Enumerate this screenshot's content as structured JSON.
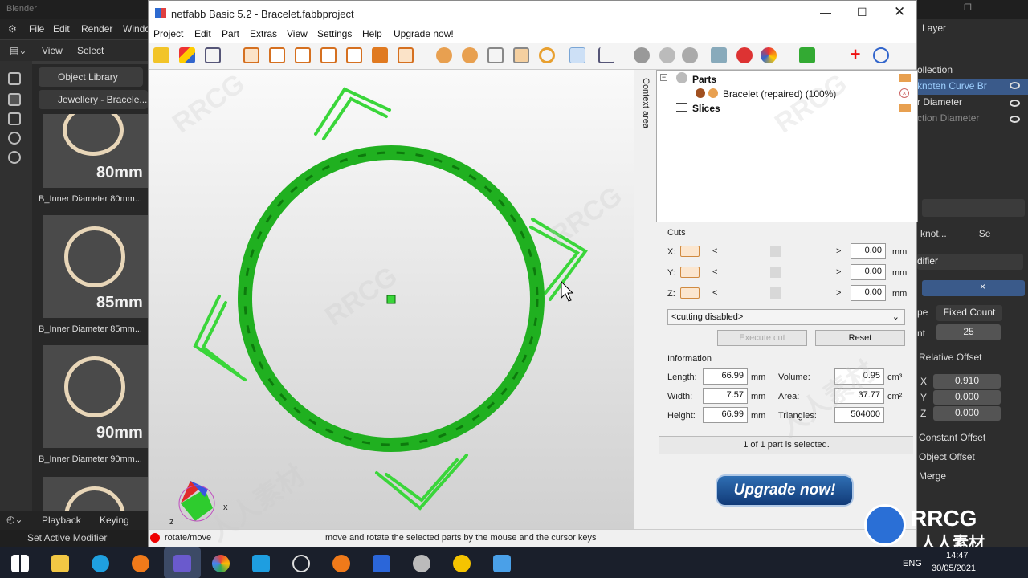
{
  "blender": {
    "title": "Blender",
    "menu": [
      "File",
      "Edit",
      "Render",
      "Windo"
    ],
    "sub_menu": [
      "View",
      "Select"
    ],
    "library_btn": "Object Library",
    "collection_btn": "Jewellery - Bracele...",
    "thumbs": [
      {
        "mm": "80mm",
        "name": "B_Inner Diameter 80mm..."
      },
      {
        "mm": "85mm",
        "name": "B_Inner Diameter 85mm..."
      },
      {
        "mm": "90mm",
        "name": "B_Inner Diameter 90mm..."
      }
    ],
    "bottom": {
      "playback": "Playback",
      "keying": "Keying"
    },
    "status": "Set Active Modifier",
    "right": {
      "layer": "Layer",
      "collection": "ollection",
      "items": [
        "knoten Curve Br",
        "r Diameter",
        "ction Diameter"
      ],
      "obj": "knot...",
      "se": "Se",
      "modifier": "difier",
      "fit_label": "pe",
      "fit_value": "Fixed Count",
      "count_label": "nt",
      "count_value": "25",
      "relative_offset": "Relative Offset",
      "offset_x_label": "X",
      "offset_x": "0.910",
      "offset_y_label": "Y",
      "offset_y": "0.000",
      "offset_z_label": "Z",
      "offset_z": "0.000",
      "constant_offset": "Constant Offset",
      "object_offset": "Object Offset",
      "merge": "Merge"
    }
  },
  "netfabb": {
    "title": "netfabb Basic 5.2 - Bracelet.fabbproject",
    "menu": [
      "Project",
      "Edit",
      "Part",
      "Extras",
      "View",
      "Settings",
      "Help",
      "Upgrade now!"
    ],
    "context_area": "Context area",
    "tree": {
      "parts": "Parts",
      "bracelet": "Bracelet (repaired) (100%)",
      "slices": "Slices"
    },
    "cuts": {
      "header": "Cuts",
      "x_label": "X:",
      "y_label": "Y:",
      "z_label": "Z:",
      "x_value": "0.00",
      "y_value": "0.00",
      "z_value": "0.00",
      "unit": "mm",
      "lt": "<",
      "gt": ">",
      "mode": "<cutting disabled>",
      "execute": "Execute cut",
      "reset": "Reset"
    },
    "info": {
      "header": "Information",
      "length_label": "Length:",
      "length": "66.99",
      "width_label": "Width:",
      "width": "7.57",
      "height_label": "Height:",
      "height": "66.99",
      "unit": "mm",
      "volume_label": "Volume:",
      "volume": "0.95",
      "volume_unit": "cm³",
      "area_label": "Area:",
      "area": "37.77",
      "area_unit": "cm²",
      "triangles_label": "Triangles:",
      "triangles": "504000"
    },
    "selection": "1 of 1 part is selected.",
    "upgrade_button": "Upgrade now!",
    "axis": {
      "x": "x",
      "z": "z"
    },
    "status_mode": "rotate/move",
    "status_hint": "move and rotate the selected parts by the mouse and the cursor keys"
  },
  "taskbar": {
    "lang": "ENG",
    "time": "14:47",
    "date": "30/05/2021"
  },
  "watermark": {
    "brand": "RRCG",
    "cn": "人人素材"
  }
}
